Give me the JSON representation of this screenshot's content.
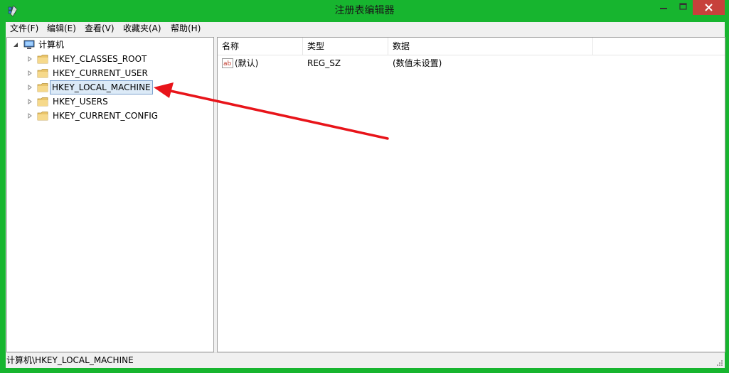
{
  "window": {
    "title": "注册表编辑器",
    "accent_color": "#17b52f",
    "close_color": "#c7413b"
  },
  "menu": [
    "文件(F)",
    "编辑(E)",
    "查看(V)",
    "收藏夹(A)",
    "帮助(H)"
  ],
  "tree": {
    "root": "计算机",
    "items": [
      {
        "label": "HKEY_CLASSES_ROOT"
      },
      {
        "label": "HKEY_CURRENT_USER"
      },
      {
        "label": "HKEY_LOCAL_MACHINE",
        "selected": true
      },
      {
        "label": "HKEY_USERS"
      },
      {
        "label": "HKEY_CURRENT_CONFIG"
      }
    ]
  },
  "list": {
    "columns": [
      "名称",
      "类型",
      "数据"
    ],
    "rows": [
      {
        "name": "(默认)",
        "type": "REG_SZ",
        "data": "(数值未设置)",
        "icon": "string-value-icon"
      }
    ]
  },
  "status": {
    "path": "计算机\\HKEY_LOCAL_MACHINE"
  },
  "annotation": {
    "type": "red-arrow",
    "color": "#e8141a",
    "target": "HKEY_LOCAL_MACHINE"
  }
}
